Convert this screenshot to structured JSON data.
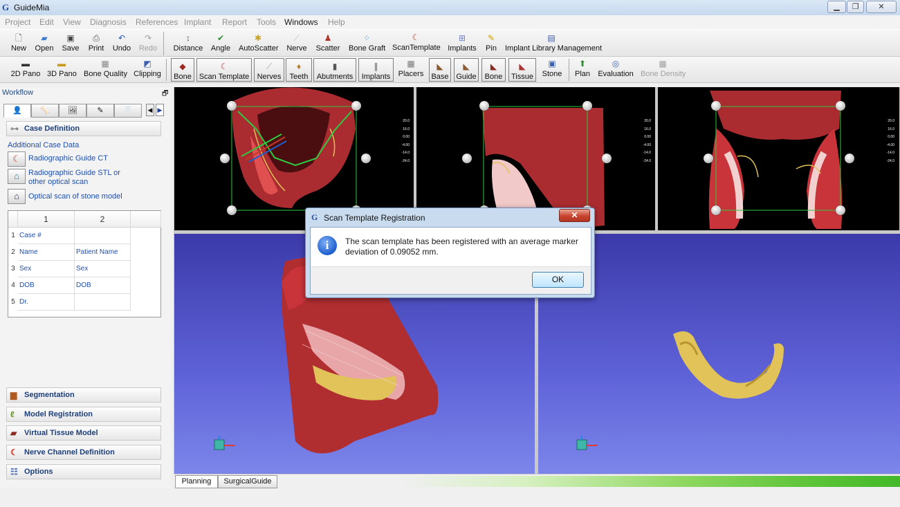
{
  "window": {
    "title": "GuideMia",
    "min_label": "▭",
    "restore_label": "❐",
    "close_label": "✕"
  },
  "menu": {
    "items": [
      "Project",
      "Edit",
      "View",
      "Diagnosis",
      "References",
      "Implant",
      "Report",
      "Tools",
      "Windows",
      "Help"
    ],
    "active": "Windows"
  },
  "toolbar1": {
    "file": [
      {
        "label": "New",
        "icon": "new-file-icon"
      },
      {
        "label": "Open",
        "icon": "open-folder-icon"
      },
      {
        "label": "Save",
        "icon": "save-icon"
      },
      {
        "label": "Print",
        "icon": "print-icon"
      },
      {
        "label": "Undo",
        "icon": "undo-icon"
      },
      {
        "label": "Redo",
        "icon": "redo-icon",
        "disabled": true
      }
    ],
    "tools": [
      {
        "label": "Distance",
        "icon": "distance-icon"
      },
      {
        "label": "Angle",
        "icon": "angle-icon"
      },
      {
        "label": "AutoScatter",
        "icon": "autoscatter-icon"
      },
      {
        "label": "Nerve",
        "icon": "nerve-icon"
      },
      {
        "label": "Scatter",
        "icon": "scatter-icon"
      },
      {
        "label": "Bone Graft",
        "icon": "bone-graft-icon"
      },
      {
        "label": "ScanTemplate",
        "icon": "scan-template-icon"
      },
      {
        "label": "Implants",
        "icon": "implants-icon"
      },
      {
        "label": "Pin",
        "icon": "pin-icon"
      },
      {
        "label": "Implant Library Management",
        "icon": "library-icon"
      }
    ]
  },
  "toolbar2": {
    "view": [
      {
        "label": "2D Pano",
        "icon": "2d-pano-icon"
      },
      {
        "label": "3D Pano",
        "icon": "3d-pano-icon"
      },
      {
        "label": "Bone Quality",
        "icon": "bone-quality-icon"
      },
      {
        "label": "Clipping",
        "icon": "clipping-icon"
      }
    ],
    "toggles": [
      {
        "label": "Bone",
        "icon": "bone-icon",
        "pressed": true
      },
      {
        "label": "Scan Template",
        "icon": "scan-template-toggle-icon",
        "pressed": true
      },
      {
        "label": "Nerves",
        "icon": "nerves-icon",
        "pressed": true
      },
      {
        "label": "Teeth",
        "icon": "teeth-icon",
        "pressed": true
      },
      {
        "label": "Abutments",
        "icon": "abutments-icon",
        "pressed": true
      },
      {
        "label": "Implants",
        "icon": "implants-toggle-icon",
        "pressed": true
      },
      {
        "label": "Placers",
        "icon": "placers-icon",
        "pressed": false
      },
      {
        "label": "Base",
        "icon": "base-icon",
        "pressed": true
      },
      {
        "label": "Guide",
        "icon": "guide-icon",
        "pressed": true
      },
      {
        "label": "Bone",
        "icon": "bone-2-icon",
        "pressed": true
      },
      {
        "label": "Tissue",
        "icon": "tissue-icon",
        "pressed": true
      },
      {
        "label": "Stone",
        "icon": "stone-icon",
        "pressed": false
      }
    ],
    "plan": [
      {
        "label": "Plan",
        "icon": "plan-icon"
      },
      {
        "label": "Evaluation",
        "icon": "evaluation-icon"
      },
      {
        "label": "Bone Density",
        "icon": "bone-density-icon",
        "disabled": true
      }
    ]
  },
  "workflow": {
    "title": "Workflow",
    "pin": "🗗",
    "tabs": [
      "👤",
      "🦴",
      "🖼",
      "✎",
      "🦷"
    ],
    "case_definition": "Case Definition",
    "additional_title": "Additional Case Data",
    "case_items": [
      {
        "label": "Radiographic Guide CT",
        "icon": "radiographic-ct-icon"
      },
      {
        "label": "Radiographic Guide STL or other optical scan",
        "icon": "optical-scan-icon"
      },
      {
        "label": "Optical scan of stone model",
        "icon": "stone-model-icon"
      }
    ],
    "grid": {
      "headers": [
        "1",
        "2"
      ],
      "rows": [
        {
          "n": "1",
          "c1": "Case #",
          "c2": ""
        },
        {
          "n": "2",
          "c1": "Name",
          "c2": "Patient Name"
        },
        {
          "n": "3",
          "c1": "Sex",
          "c2": "Sex"
        },
        {
          "n": "4",
          "c1": "DOB",
          "c2": "DOB"
        },
        {
          "n": "5",
          "c1": "Dr.",
          "c2": ""
        }
      ]
    },
    "sections": [
      {
        "label": "Segmentation",
        "icon": "segmentation-icon"
      },
      {
        "label": "Model Registration",
        "icon": "model-registration-icon"
      },
      {
        "label": "Virtual Tissue Model",
        "icon": "virtual-tissue-icon"
      },
      {
        "label": "Nerve Channel Definition",
        "icon": "nerve-channel-icon"
      },
      {
        "label": "Options",
        "icon": "options-icon"
      }
    ]
  },
  "ruler": [
    "20.0",
    "16.0",
    "0.00",
    "-4.00",
    "-14.0",
    "-24.0"
  ],
  "bottom_tabs": [
    {
      "label": "Planning",
      "selected": true
    },
    {
      "label": "SurgicalGuide",
      "selected": false
    }
  ],
  "dialog": {
    "title": "Scan Template Registration",
    "close": "✕",
    "icon": "i",
    "message": "The scan template has been registered with an average marker deviation of 0.09052 mm.",
    "ok": "OK"
  },
  "colors": {
    "bone": "#c8343a",
    "guide": "#e2c35a",
    "viewport_bg": "#3c3aaa",
    "accent": "#1d4fb0"
  }
}
